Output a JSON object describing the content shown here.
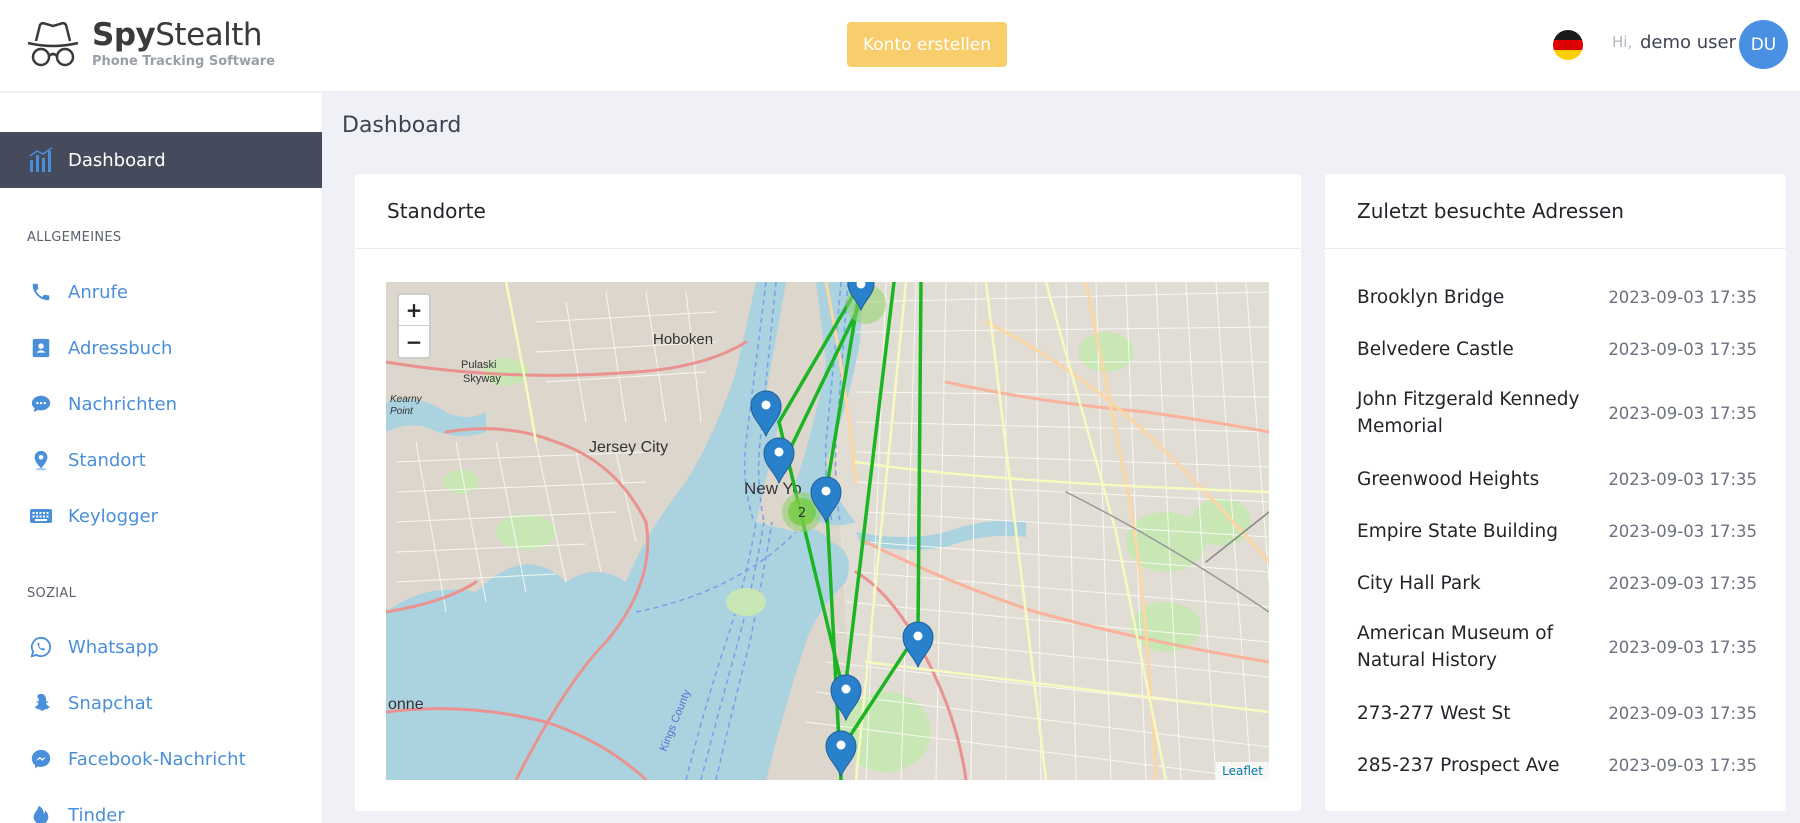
{
  "header": {
    "logo_name_bold": "Spy",
    "logo_name_rest": "Stealth",
    "logo_tagline": "Phone Tracking Software",
    "cta_label": "Konto erstellen",
    "greeting": "Hi,",
    "username": "demo user",
    "avatar_initials": "DU",
    "flag": "germany-flag"
  },
  "sidebar": {
    "active": {
      "label": "Dashboard",
      "icon": "bar-chart-icon"
    },
    "section_general": "ALLGEMEINES",
    "general_items": [
      {
        "label": "Anrufe",
        "icon": "phone-icon"
      },
      {
        "label": "Adressbuch",
        "icon": "contact-book-icon"
      },
      {
        "label": "Nachrichten",
        "icon": "sms-icon"
      },
      {
        "label": "Standort",
        "icon": "location-pin-icon"
      },
      {
        "label": "Keylogger",
        "icon": "keyboard-icon"
      }
    ],
    "section_social": "SOZIAL",
    "social_items": [
      {
        "label": "Whatsapp",
        "icon": "whatsapp-icon"
      },
      {
        "label": "Snapchat",
        "icon": "snapchat-icon"
      },
      {
        "label": "Facebook-Nachricht",
        "icon": "messenger-icon"
      },
      {
        "label": "Tinder",
        "icon": "tinder-icon"
      }
    ]
  },
  "page": {
    "title": "Dashboard"
  },
  "map_card": {
    "title": "Standorte",
    "zoom_in": "+",
    "zoom_out": "−",
    "attribution": "Leaflet",
    "labels": {
      "hoboken": "Hoboken",
      "jersey_city": "Jersey City",
      "new_york": "New Yo",
      "pulaski": "Pulaski",
      "skyway": "Skyway",
      "kearny": "Kearny",
      "point": "Point",
      "bayonne": "onne",
      "kings_county": "Kings County"
    },
    "cluster_count": "2"
  },
  "addresses_card": {
    "title": "Zuletzt besuchte Adressen",
    "rows": [
      {
        "name": "Brooklyn Bridge",
        "time": "2023-09-03 17:35"
      },
      {
        "name": "Belvedere Castle",
        "time": "2023-09-03 17:35"
      },
      {
        "name": "John Fitzgerald Kennedy Memorial",
        "time": "2023-09-03 17:35"
      },
      {
        "name": "Greenwood Heights",
        "time": "2023-09-03 17:35"
      },
      {
        "name": "Empire State Building",
        "time": "2023-09-03 17:35"
      },
      {
        "name": "City Hall Park",
        "time": "2023-09-03 17:35"
      },
      {
        "name": "American Museum of Natural History",
        "time": "2023-09-03 17:35"
      },
      {
        "name": "273-277 West St",
        "time": "2023-09-03 17:35"
      },
      {
        "name": "285-237 Prospect Ave",
        "time": "2023-09-03 17:35"
      }
    ]
  },
  "colors": {
    "accent": "#4a8fd9",
    "cta": "#f8ce6c",
    "active_nav": "#454b5c",
    "route": "#1bb524",
    "marker": "#2a81cb"
  }
}
